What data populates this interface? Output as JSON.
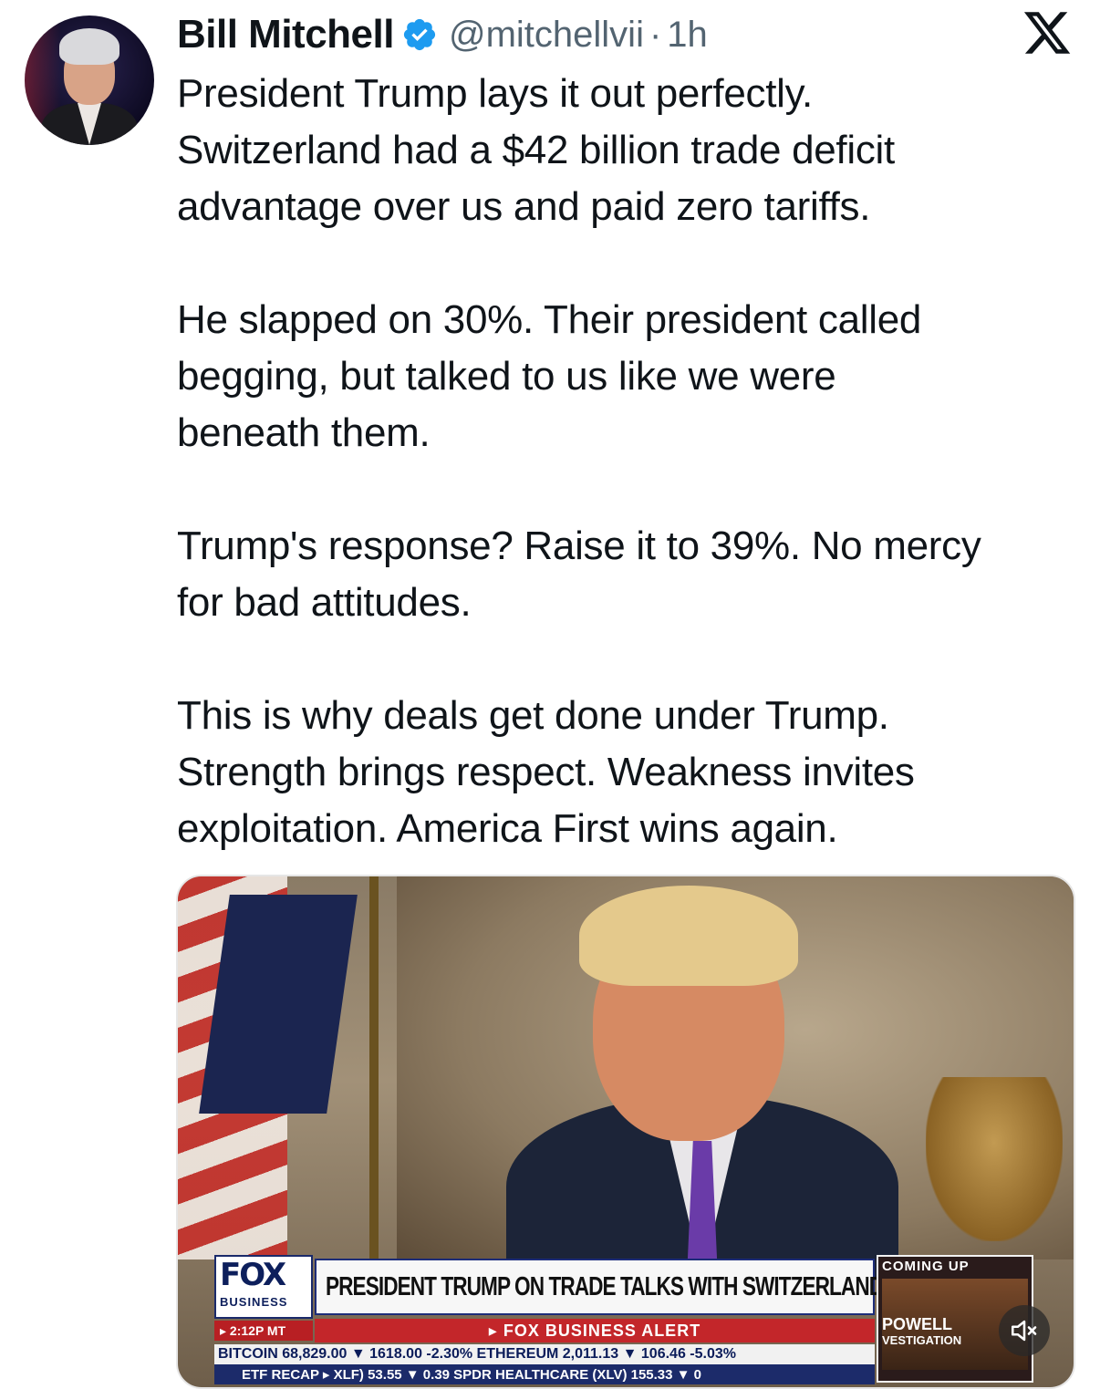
{
  "tweet": {
    "author_name": "Bill Mitchell",
    "handle": "@mitchellvii",
    "separator": "·",
    "time": "1h",
    "paragraphs": [
      "President Trump lays it out perfectly.\nSwitzerland had a $42 billion trade deficit\nadvantage over us and paid zero tariffs.",
      "He slapped on 30%. Their president called\nbegging, but talked to us like we were\nbeneath them.",
      "Trump's response? Raise it to 39%. No mercy\nfor bad attitudes.",
      "This is why deals get done under Trump.\nStrength brings respect. Weakness invites\nexploitation. America First wins again."
    ]
  },
  "icons": {
    "verified": "verified-badge-icon",
    "platform": "x-logo-icon",
    "mute": "muted-speaker-icon"
  },
  "colors": {
    "verified_blue": "#1d9bf0",
    "text_primary": "#0f1419",
    "text_secondary": "#536471"
  },
  "video": {
    "network_logo": "FOX",
    "network_sub": "BUSINESS",
    "headline": "PRESIDENT TRUMP ON TRADE TALKS WITH SWITZERLAND",
    "time_chip": "▸ 2:12P MT",
    "alert": "▸ FOX BUSINESS ALERT",
    "ticker_line1": "BITCOIN  68,829.00 ▼ 1618.00  -2.30%   ETHEREUM  2,011.13 ▼ 106.46  -5.03%",
    "ticker_line2": "ETF RECAP  ▸ XLF)  53.55 ▼ 0.39   SPDR HEALTHCARE (XLV)  155.33 ▼ 0",
    "coming_up_label": "COMING UP",
    "coming_up_topic": "POWELL",
    "coming_up_sub": "VESTIGATION"
  }
}
